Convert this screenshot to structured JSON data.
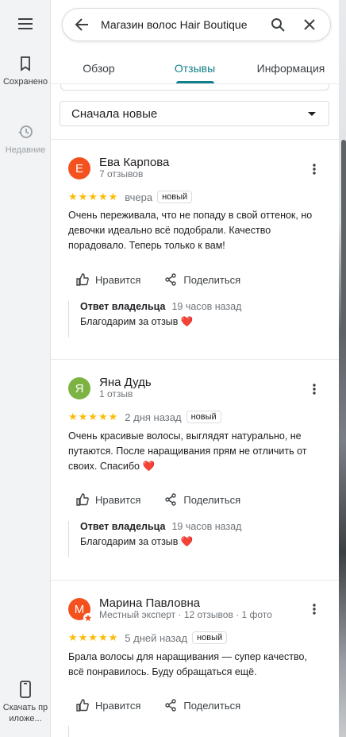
{
  "rail": {
    "saved_label": "Сохранено",
    "recent_label": "Недавние",
    "download_label": "Скачать приложе..."
  },
  "search": {
    "query": "Магазин волос Hair Boutique"
  },
  "tabs": [
    {
      "label": "Обзор"
    },
    {
      "label": "Отзывы"
    },
    {
      "label": "Информация"
    }
  ],
  "sort": {
    "selected": "Сначала новые"
  },
  "colors": {
    "accent": "#137f8a",
    "star": "#fbbc04"
  },
  "reviews": [
    {
      "initial": "Е",
      "avatar_color": "#f4511e",
      "name": "Ева Карпова",
      "sub": "7 отзывов",
      "stars": "★★★★★",
      "time": "вчера",
      "badge": "новый",
      "text": "Очень переживала, что не попаду в свой оттенок, но девочки идеально всё подобрали. Качество порадовало. Теперь только к вам!",
      "like": "Нравится",
      "share": "Поделиться",
      "owner_label": "Ответ владельца",
      "owner_time": "19 часов назад",
      "owner_text": "Благодарим за отзыв",
      "heart": "❤️"
    },
    {
      "initial": "Я",
      "avatar_color": "#7cb342",
      "name": "Яна Дудь",
      "sub": "1 отзыв",
      "stars": "★★★★★",
      "time": "2 дня назад",
      "badge": "новый",
      "text": "Очень красивые волосы, выглядят натурально, не путаются. После наращивания прям не отличить от своих. Спасибо",
      "heart_inline": "❤️",
      "like": "Нравится",
      "share": "Поделиться",
      "owner_label": "Ответ владельца",
      "owner_time": "19 часов назад",
      "owner_text": "Благодарим за отзыв",
      "heart": "❤️"
    },
    {
      "initial": "М",
      "avatar_color": "#f4511e",
      "name": "Марина Павловна",
      "sub": "Местный эксперт · 12 отзывов · 1 фото",
      "stars": "★★★★★",
      "time": "5 дней назад",
      "badge": "новый",
      "text": "Брала волосы для наращивания — супер качество, всё понравилось. Буду обращаться ещё.",
      "like": "Нравится",
      "share": "Поделиться"
    }
  ]
}
